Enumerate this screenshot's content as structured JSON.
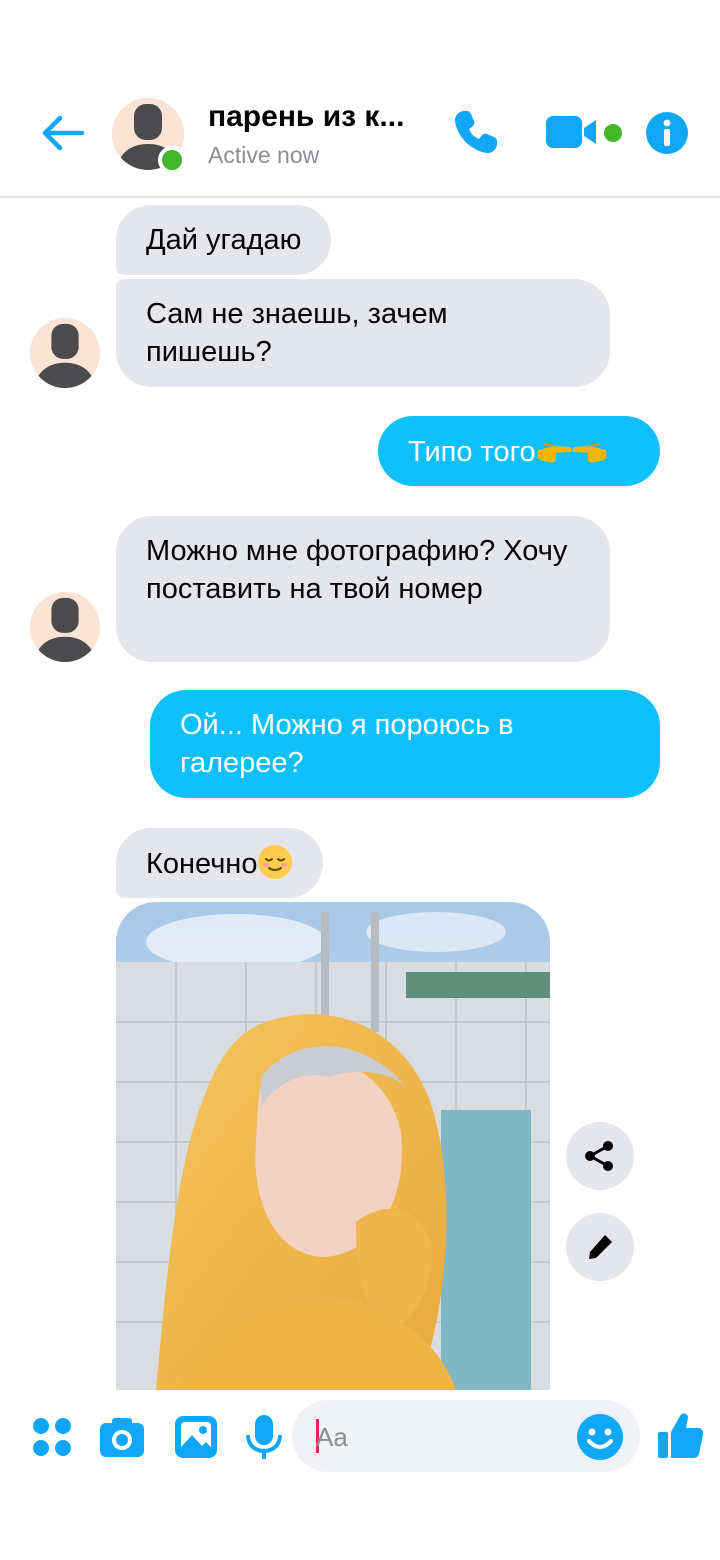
{
  "header": {
    "contact_name": "парень из к...",
    "status": "Active now"
  },
  "messages": [
    {
      "side": "in",
      "text": "Дай угадаю"
    },
    {
      "side": "in",
      "text": "Сам не знаешь, зачем пишешь?"
    },
    {
      "side": "out",
      "text": "Типо того",
      "emoji": [
        "backhand-index-pointing-right",
        "backhand-index-pointing-left"
      ]
    },
    {
      "side": "in",
      "text": "Можно мне фотографию? Хочу поставить на твой номер"
    },
    {
      "side": "out",
      "text": "Ой... Можно я пороюсь в галерее?"
    },
    {
      "side": "in",
      "text": "Конечно",
      "emoji": [
        "relieved-face"
      ]
    },
    {
      "side": "in",
      "type": "photo"
    }
  ],
  "composer": {
    "placeholder": "Aa"
  },
  "colors": {
    "accent": "#10c0fb",
    "incoming_bubble": "#e4e6eb",
    "online": "#42b72a"
  }
}
